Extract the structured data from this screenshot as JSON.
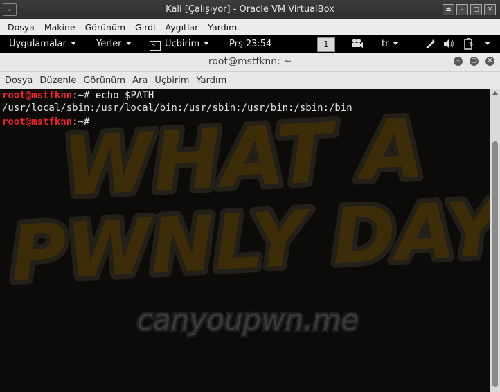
{
  "vbox": {
    "title": "Kali [Çalışıyor] - Oracle VM VirtualBox",
    "menu": [
      "Dosya",
      "Makine",
      "Görünüm",
      "Girdi",
      "Aygıtlar",
      "Yardım"
    ]
  },
  "panel": {
    "applications": "Uygulamalar",
    "places": "Yerler",
    "terminal_app": "Uçbirim",
    "clock": "Prş 23:54",
    "workspace": "1",
    "keyboard_layout": "tr",
    "icons": [
      "camera-icon",
      "pen-icon",
      "volume-icon",
      "battery-icon",
      "power-menu-icon"
    ]
  },
  "terminal": {
    "title": "root@mstfknn: ~",
    "menu": [
      "Dosya",
      "Düzenle",
      "Görünüm",
      "Ara",
      "Uçbirim",
      "Yardım"
    ],
    "lines": [
      {
        "user": "root@mstfknn",
        "rest": ":~# echo $PATH"
      },
      {
        "output": "/usr/local/sbin:/usr/local/bin:/usr/sbin:/usr/bin:/sbin:/bin"
      },
      {
        "user": "root@mstfknn",
        "rest": ":~# "
      }
    ],
    "wallpaper_text": {
      "line1": "WHAT A",
      "line2": "PWNLY DAY",
      "site": "canyoupwn.me"
    }
  },
  "colors": {
    "prompt_user": "#e5252a",
    "wallpaper_accent": "#7a5a0e",
    "terminal_bg": "#0c0b09"
  }
}
